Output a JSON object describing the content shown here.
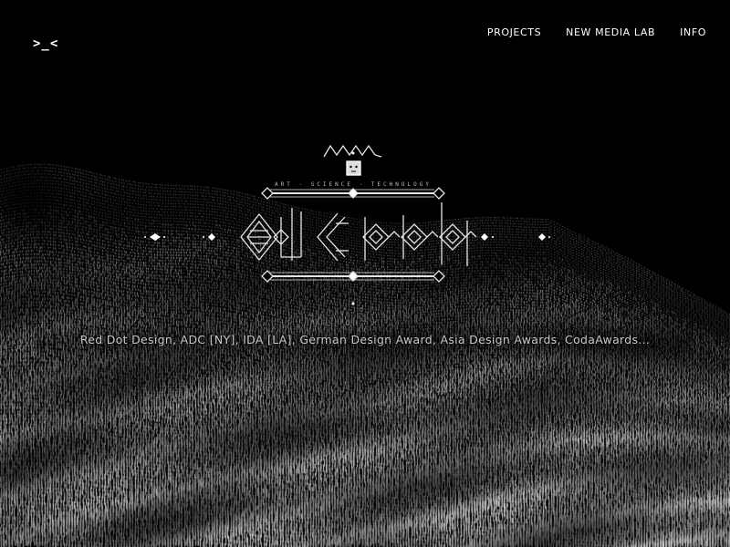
{
  "header": {
    "logo_text": ">_<",
    "nav": [
      {
        "label": "PROJECTS"
      },
      {
        "label": "NEW MEDIA LAB"
      },
      {
        "label": "INFO"
      }
    ]
  },
  "hero": {
    "emblem_subtitle": "ART · SCIENCE · TECHNOLOGY",
    "awards_text": "Red Dot Design, ADC [NY], IDA [LA], German Design Award, Asia Design Awards, CodaAwards..."
  },
  "colors": {
    "background": "#000000",
    "foreground": "#ffffff",
    "muted_text": "#c9c9c9"
  },
  "icons": {
    "emblem": "geometric-glyph-emblem",
    "background": "dot-matrix-terrain"
  }
}
